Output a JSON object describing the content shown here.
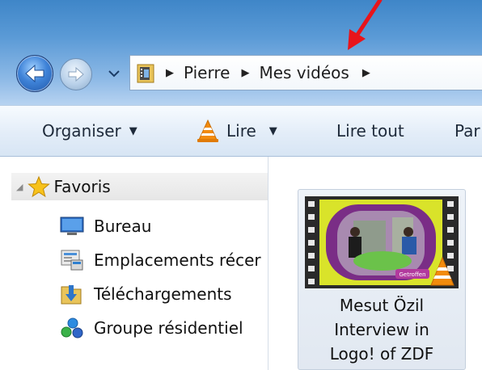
{
  "address": {
    "crumbs": [
      "Pierre",
      "Mes vidéos"
    ]
  },
  "toolbar": {
    "organize": "Organiser",
    "play": "Lire",
    "play_all": "Lire tout",
    "partial": "Par"
  },
  "navpane": {
    "favorites": "Favoris",
    "items": [
      {
        "label": "Bureau",
        "icon": "desktop-icon"
      },
      {
        "label": "Emplacements récer",
        "icon": "recent-places-icon"
      },
      {
        "label": "Téléchargements",
        "icon": "downloads-icon"
      },
      {
        "label": "Groupe résidentiel",
        "icon": "homegroup-icon"
      }
    ]
  },
  "content": {
    "file": {
      "name_lines": [
        "Mesut Özil",
        "Interview in",
        "Logo! of ZDF"
      ],
      "thumb_caption": "Getroffen"
    }
  },
  "colors": {
    "annotation_arrow": "#e8141b",
    "vlc_orange": "#f28b0c",
    "title_bar": "#4c8fd0"
  }
}
